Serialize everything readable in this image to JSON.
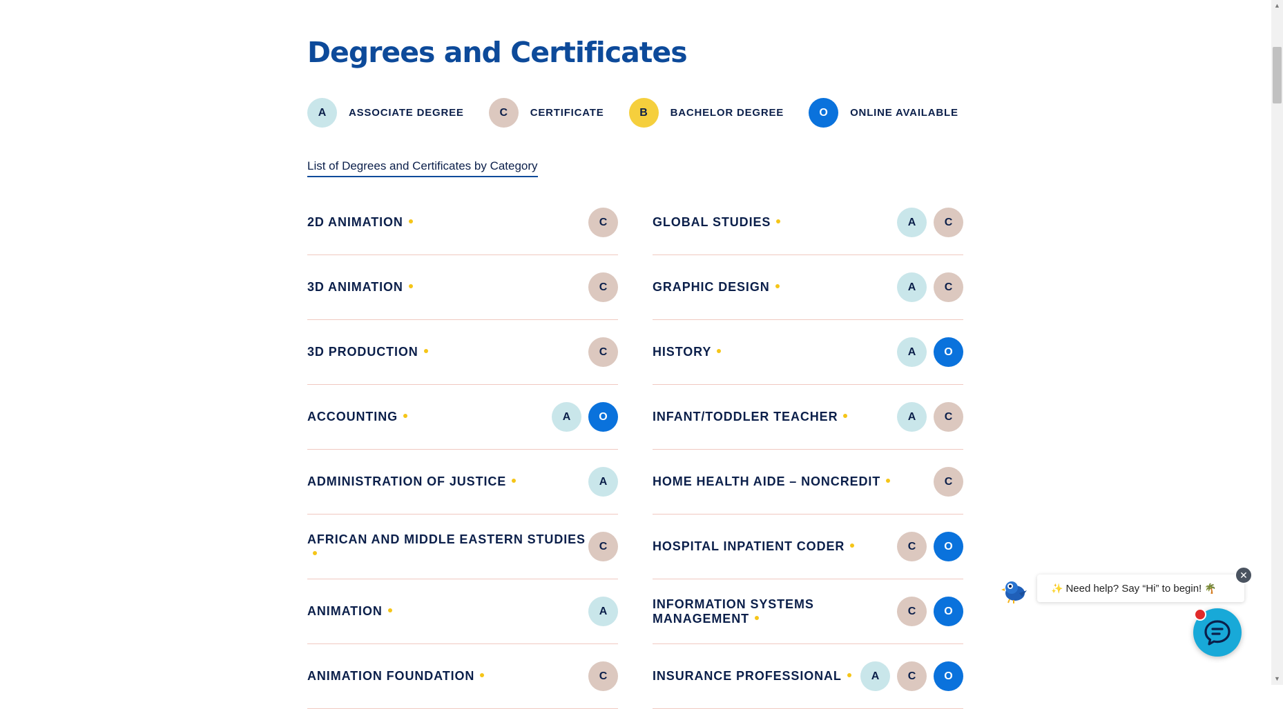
{
  "page": {
    "title": "Degrees and Certificates"
  },
  "legend": [
    {
      "code": "A",
      "label": "ASSOCIATE DEGREE",
      "type": "A"
    },
    {
      "code": "C",
      "label": "CERTIFICATE",
      "type": "C"
    },
    {
      "code": "B",
      "label": "BACHELOR DEGREE",
      "type": "B"
    },
    {
      "code": "O",
      "label": "ONLINE AVAILABLE",
      "type": "O"
    }
  ],
  "category_link": "List of Degrees and Certificates by Category",
  "programs_left": [
    {
      "name": "2D ANIMATION",
      "badges": [
        "C"
      ]
    },
    {
      "name": "3D ANIMATION",
      "badges": [
        "C"
      ]
    },
    {
      "name": "3D PRODUCTION",
      "badges": [
        "C"
      ]
    },
    {
      "name": "ACCOUNTING",
      "badges": [
        "A",
        "O"
      ]
    },
    {
      "name": "ADMINISTRATION OF JUSTICE",
      "badges": [
        "A"
      ]
    },
    {
      "name": "AFRICAN AND MIDDLE EASTERN STUDIES",
      "badges": [
        "C"
      ]
    },
    {
      "name": "ANIMATION",
      "badges": [
        "A"
      ]
    },
    {
      "name": "ANIMATION FOUNDATION",
      "badges": [
        "C"
      ]
    }
  ],
  "programs_right": [
    {
      "name": "GLOBAL STUDIES",
      "badges": [
        "A",
        "C"
      ]
    },
    {
      "name": "GRAPHIC DESIGN",
      "badges": [
        "A",
        "C"
      ]
    },
    {
      "name": "HISTORY",
      "badges": [
        "A",
        "O"
      ]
    },
    {
      "name": "INFANT/TODDLER TEACHER",
      "badges": [
        "A",
        "C"
      ]
    },
    {
      "name": "HOME HEALTH AIDE – NONCREDIT",
      "badges": [
        "C"
      ]
    },
    {
      "name": "HOSPITAL INPATIENT CODER",
      "badges": [
        "C",
        "O"
      ]
    },
    {
      "name": "INFORMATION SYSTEMS MANAGEMENT",
      "badges": [
        "C",
        "O"
      ]
    },
    {
      "name": "INSURANCE PROFESSIONAL",
      "badges": [
        "A",
        "C",
        "O"
      ]
    }
  ],
  "chat": {
    "prompt": "Need help? Say “Hi” to begin!",
    "emoji_left": "✨",
    "emoji_right": "🌴",
    "close_symbol": "✕"
  },
  "colors": {
    "title": "#0d4a9a",
    "text": "#0b1f4a",
    "associate": "#c9e6ea",
    "certificate": "#dcc8bf",
    "bachelor": "#f5cf3d",
    "online": "#0a72dc",
    "dot": "#f5c518",
    "divider": "#f0c8c0",
    "chat_launcher": "#18a9d8"
  },
  "icons": [
    "chat-launcher-icon",
    "chat-close-icon",
    "bird-avatar-icon",
    "scroll-up-arrow-icon",
    "scroll-down-arrow-icon"
  ]
}
